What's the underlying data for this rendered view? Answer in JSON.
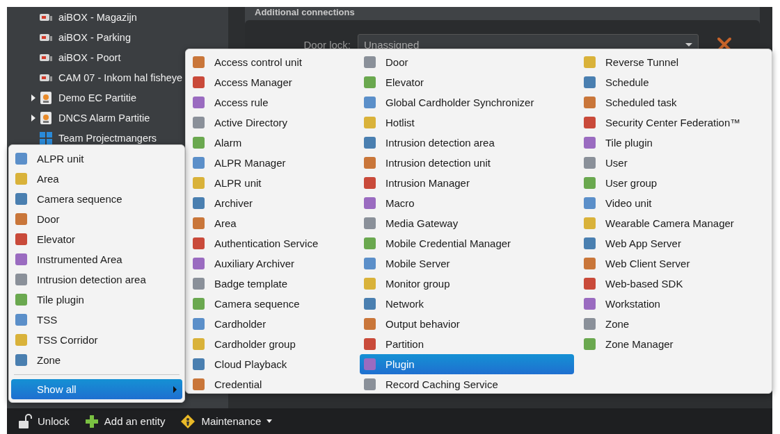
{
  "tree": {
    "items": [
      {
        "kind": "camera",
        "label": "aiBOX - Magazijn"
      },
      {
        "kind": "camera",
        "label": "aiBOX - Parking"
      },
      {
        "kind": "camera",
        "label": "aiBOX - Poort"
      },
      {
        "kind": "camera",
        "label": "CAM 07 - Inkom hal fisheye"
      },
      {
        "kind": "partition",
        "label": "Demo EC Partitie",
        "expanded": false
      },
      {
        "kind": "partition",
        "label": "DNCS Alarm Partitie",
        "expanded": false
      },
      {
        "kind": "team",
        "label": "Team Projectmangers"
      }
    ]
  },
  "connections": {
    "title": "Additional connections",
    "rows": [
      {
        "label": "Door lock:",
        "value": "Unassigned"
      }
    ]
  },
  "quick_menu": {
    "items": [
      {
        "label": "ALPR unit",
        "selected": false
      },
      {
        "label": "Area",
        "selected": false
      },
      {
        "label": "Camera sequence",
        "selected": false
      },
      {
        "label": "Door",
        "selected": false
      },
      {
        "label": "Elevator",
        "selected": false
      },
      {
        "label": "Instrumented Area",
        "selected": false
      },
      {
        "label": "Intrusion detection area",
        "selected": false
      },
      {
        "label": "Tile plugin",
        "selected": false
      },
      {
        "label": "TSS",
        "selected": false
      },
      {
        "label": "TSS Corridor",
        "selected": false
      },
      {
        "label": "Zone",
        "selected": false
      }
    ],
    "show_all": {
      "label": "Show all",
      "selected": true
    }
  },
  "entity_menu": {
    "columns": [
      [
        {
          "label": "Access control unit",
          "selected": false
        },
        {
          "label": "Access Manager",
          "selected": false
        },
        {
          "label": "Access rule",
          "selected": false
        },
        {
          "label": "Active Directory",
          "selected": false
        },
        {
          "label": "Alarm",
          "selected": false
        },
        {
          "label": "ALPR Manager",
          "selected": false
        },
        {
          "label": "ALPR unit",
          "selected": false
        },
        {
          "label": "Archiver",
          "selected": false
        },
        {
          "label": "Area",
          "selected": false
        },
        {
          "label": "Authentication Service",
          "selected": false
        },
        {
          "label": "Auxiliary Archiver",
          "selected": false
        },
        {
          "label": "Badge template",
          "selected": false
        },
        {
          "label": "Camera sequence",
          "selected": false
        },
        {
          "label": "Cardholder",
          "selected": false
        },
        {
          "label": "Cardholder group",
          "selected": false
        },
        {
          "label": "Cloud Playback",
          "selected": false
        },
        {
          "label": "Credential",
          "selected": false
        }
      ],
      [
        {
          "label": "Door",
          "selected": false
        },
        {
          "label": "Elevator",
          "selected": false
        },
        {
          "label": "Global Cardholder Synchronizer",
          "selected": false
        },
        {
          "label": "Hotlist",
          "selected": false
        },
        {
          "label": "Intrusion detection area",
          "selected": false
        },
        {
          "label": "Intrusion detection unit",
          "selected": false
        },
        {
          "label": "Intrusion Manager",
          "selected": false
        },
        {
          "label": "Macro",
          "selected": false
        },
        {
          "label": "Media Gateway",
          "selected": false
        },
        {
          "label": "Mobile Credential Manager",
          "selected": false
        },
        {
          "label": "Mobile Server",
          "selected": false
        },
        {
          "label": "Monitor group",
          "selected": false
        },
        {
          "label": "Network",
          "selected": false
        },
        {
          "label": "Output behavior",
          "selected": false
        },
        {
          "label": "Partition",
          "selected": false
        },
        {
          "label": "Plugin",
          "selected": true
        },
        {
          "label": "Record Caching Service",
          "selected": false
        }
      ],
      [
        {
          "label": "Reverse Tunnel",
          "selected": false
        },
        {
          "label": "Schedule",
          "selected": false
        },
        {
          "label": "Scheduled task",
          "selected": false
        },
        {
          "label": "Security Center Federation™",
          "selected": false
        },
        {
          "label": "Tile plugin",
          "selected": false
        },
        {
          "label": "User",
          "selected": false
        },
        {
          "label": "User group",
          "selected": false
        },
        {
          "label": "Video unit",
          "selected": false
        },
        {
          "label": "Wearable Camera Manager",
          "selected": false
        },
        {
          "label": "Web App Server",
          "selected": false
        },
        {
          "label": "Web Client Server",
          "selected": false
        },
        {
          "label": "Web-based SDK",
          "selected": false
        },
        {
          "label": "Workstation",
          "selected": false
        },
        {
          "label": "Zone",
          "selected": false
        },
        {
          "label": "Zone Manager",
          "selected": false
        }
      ]
    ]
  },
  "toolbar": {
    "items": [
      {
        "kind": "unlock",
        "label": "Unlock"
      },
      {
        "kind": "add",
        "label": "Add an entity"
      },
      {
        "kind": "maintenance",
        "label": "Maintenance"
      }
    ]
  }
}
